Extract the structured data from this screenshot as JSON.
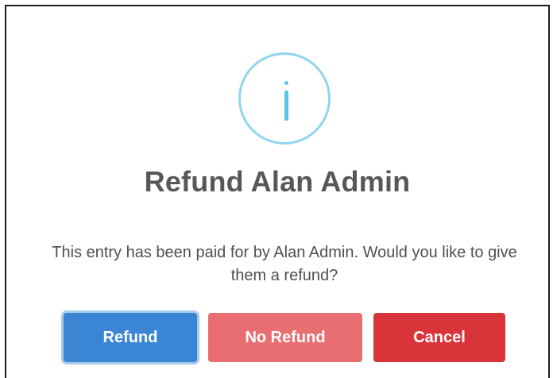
{
  "dialog": {
    "icon": "info-icon",
    "title": "Refund Alan Admin",
    "message": "This entry has been paid for by Alan Admin. Would you like to give them a refund?",
    "buttons": {
      "refund": "Refund",
      "no_refund": "No Refund",
      "cancel": "Cancel"
    }
  },
  "colors": {
    "icon": "#5fc3e8",
    "refund": "#3a86d4",
    "no_refund": "#e86e71",
    "cancel": "#d9343a"
  }
}
